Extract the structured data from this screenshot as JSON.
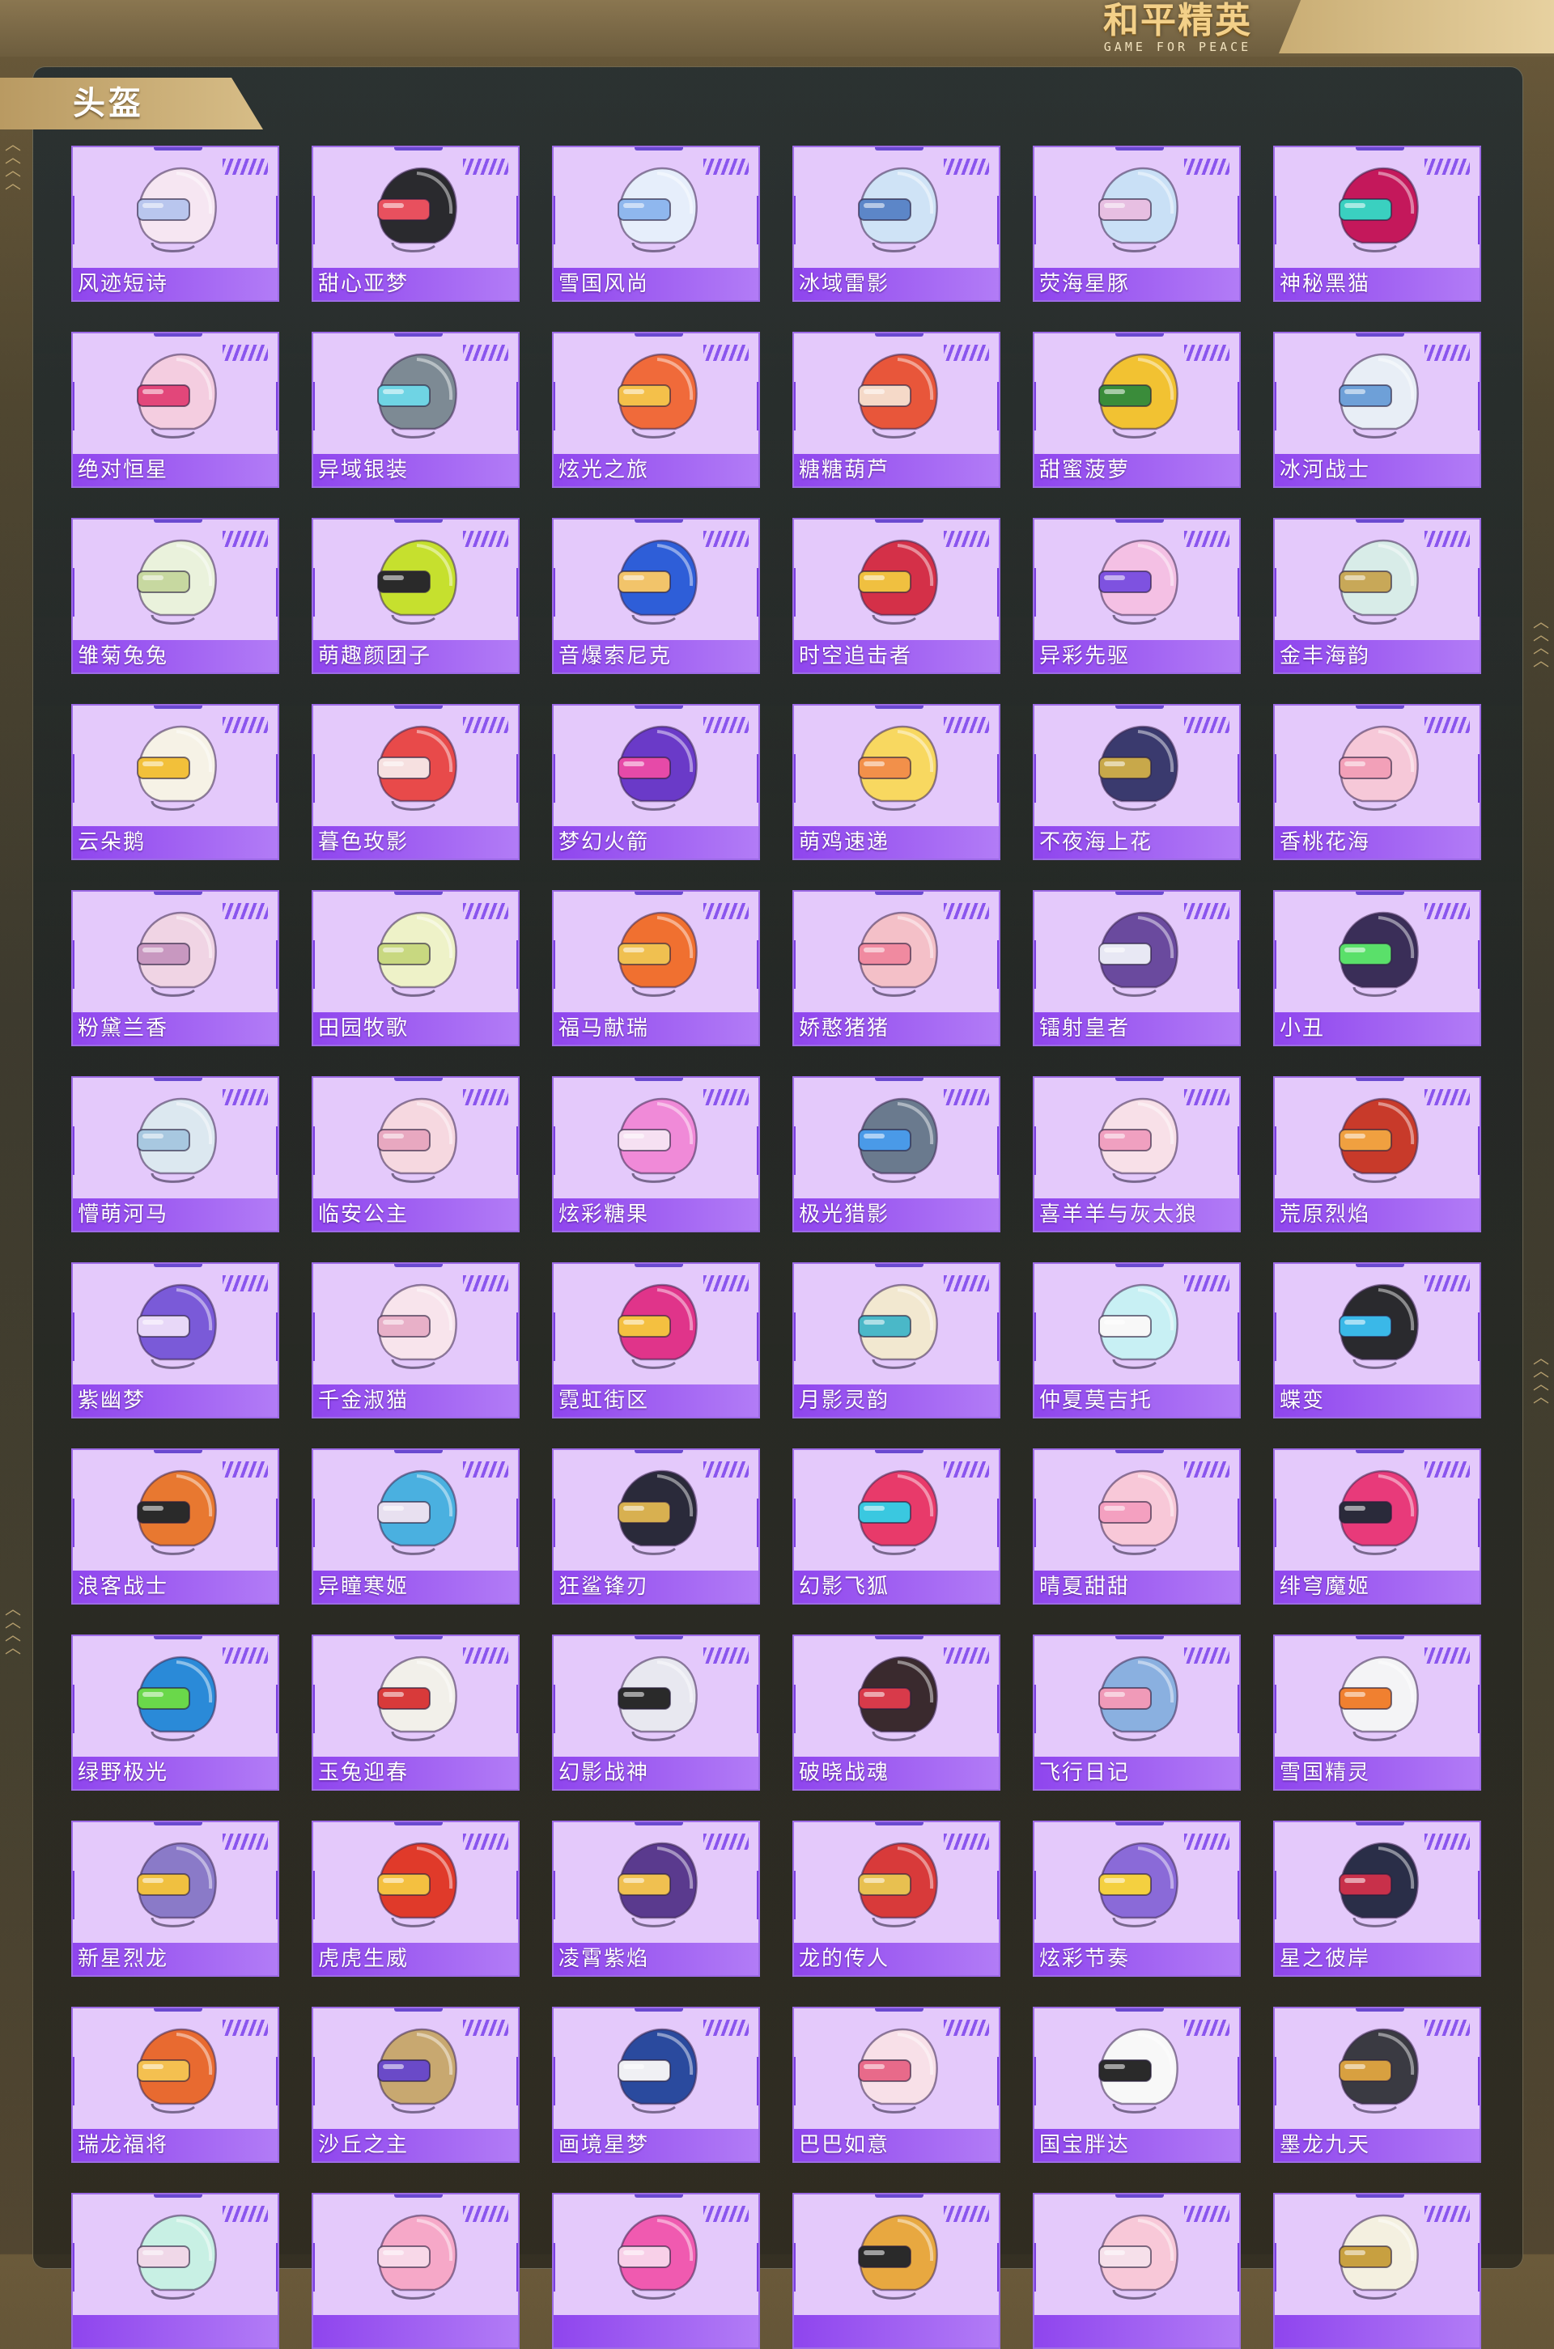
{
  "brand": {
    "name_cn": "和平精英",
    "name_en": "GAME FOR PEACE"
  },
  "section": {
    "title": "头盔"
  },
  "accent_colors": {
    "card_bg": "#e4c9fb",
    "label_bar": "#8f45ee",
    "header_gold": "#c9ad74"
  },
  "items": [
    {
      "label": "风迹短诗",
      "c1": "#f6e6f2",
      "c2": "#b9c6ee"
    },
    {
      "label": "甜心亚梦",
      "c1": "#2a2a2e",
      "c2": "#e8505e"
    },
    {
      "label": "雪国风尚",
      "c1": "#e6eefb",
      "c2": "#8fb7ee"
    },
    {
      "label": "冰域雷影",
      "c1": "#cfe3f6",
      "c2": "#5c86c8"
    },
    {
      "label": "荧海星豚",
      "c1": "#c9e0f6",
      "c2": "#e7bfe2"
    },
    {
      "label": "神秘黑猫",
      "c1": "#c4185b",
      "c2": "#3ad0c0"
    },
    {
      "label": "绝对恒星",
      "c1": "#f4cde0",
      "c2": "#e2477a"
    },
    {
      "label": "异域银装",
      "c1": "#7d8a94",
      "c2": "#6fd4e4"
    },
    {
      "label": "炫光之旅",
      "c1": "#f06a3a",
      "c2": "#f4c04a"
    },
    {
      "label": "糖糖葫芦",
      "c1": "#e8563a",
      "c2": "#f5d9c8"
    },
    {
      "label": "甜蜜菠萝",
      "c1": "#f2c232",
      "c2": "#3a8c3a"
    },
    {
      "label": "冰河战士",
      "c1": "#e8eef6",
      "c2": "#6ea0d8"
    },
    {
      "label": "雏菊兔兔",
      "c1": "#eaf2dc",
      "c2": "#c7d8a0"
    },
    {
      "label": "萌趣颜团子",
      "c1": "#c6e02e",
      "c2": "#2a2a2a"
    },
    {
      "label": "音爆索尼克",
      "c1": "#2e5ed8",
      "c2": "#f2c46a"
    },
    {
      "label": "时空追击者",
      "c1": "#d43048",
      "c2": "#f0c040"
    },
    {
      "label": "异彩先驱",
      "c1": "#f4c0e4",
      "c2": "#7e52e0"
    },
    {
      "label": "金丰海韵",
      "c1": "#d8ece8",
      "c2": "#c8a858"
    },
    {
      "label": "云朵鹅",
      "c1": "#f6f2e6",
      "c2": "#f2c03a"
    },
    {
      "label": "暮色玫影",
      "c1": "#e84a4a",
      "c2": "#f6e0e0"
    },
    {
      "label": "梦幻火箭",
      "c1": "#6a3ac8",
      "c2": "#e64aa8"
    },
    {
      "label": "萌鸡速递",
      "c1": "#f8d860",
      "c2": "#f2904a"
    },
    {
      "label": "不夜海上花",
      "c1": "#3a3a6e",
      "c2": "#c8a84a"
    },
    {
      "label": "香桃花海",
      "c1": "#f6c8d8",
      "c2": "#f2a0b8"
    },
    {
      "label": "粉黛兰香",
      "c1": "#f0d4e4",
      "c2": "#c898c0"
    },
    {
      "label": "田园牧歌",
      "c1": "#eef2c8",
      "c2": "#c8d880"
    },
    {
      "label": "福马献瑞",
      "c1": "#f07030",
      "c2": "#f0c050"
    },
    {
      "label": "娇憨猪猪",
      "c1": "#f4c0c8",
      "c2": "#f08aa0"
    },
    {
      "label": "镭射皇者",
      "c1": "#6a4a9e",
      "c2": "#e8e8f4"
    },
    {
      "label": "小丑",
      "c1": "#3a2e58",
      "c2": "#5ae06a"
    },
    {
      "label": "懵萌河马",
      "c1": "#dce8f0",
      "c2": "#a8c8e0"
    },
    {
      "label": "临安公主",
      "c1": "#f6d8e0",
      "c2": "#e8a8c0"
    },
    {
      "label": "炫彩糖果",
      "c1": "#f08ad8",
      "c2": "#f6e0f2"
    },
    {
      "label": "极光猎影",
      "c1": "#6a7a8e",
      "c2": "#4a9ae8"
    },
    {
      "label": "喜羊羊与灰太狼",
      "c1": "#f8e0e8",
      "c2": "#f0a0c0"
    },
    {
      "label": "荒原烈焰",
      "c1": "#c83a2a",
      "c2": "#f0a040"
    },
    {
      "label": "紫幽梦",
      "c1": "#7a5ad8",
      "c2": "#e8d8f8"
    },
    {
      "label": "千金淑猫",
      "c1": "#f8e4ec",
      "c2": "#e8b0c8"
    },
    {
      "label": "霓虹街区",
      "c1": "#e0348a",
      "c2": "#f4c040"
    },
    {
      "label": "月影灵韵",
      "c1": "#f2e8d0",
      "c2": "#4ab8c8"
    },
    {
      "label": "仲夏莫吉托",
      "c1": "#c8f0f4",
      "c2": "#f8f8f8"
    },
    {
      "label": "蝶变",
      "c1": "#2a2a2e",
      "c2": "#3ab8e8"
    },
    {
      "label": "浪客战士",
      "c1": "#e87830",
      "c2": "#2a2a2a"
    },
    {
      "label": "异瞳寒姬",
      "c1": "#4ab0e0",
      "c2": "#e8e0f0"
    },
    {
      "label": "狂鲨锋刃",
      "c1": "#2a2a3a",
      "c2": "#d8b050"
    },
    {
      "label": "幻影飞狐",
      "c1": "#e83a6a",
      "c2": "#3ac8e0"
    },
    {
      "label": "晴夏甜甜",
      "c1": "#f8c8d8",
      "c2": "#f4a0c0"
    },
    {
      "label": "绯穹魔姬",
      "c1": "#e83a7a",
      "c2": "#2a2a3a"
    },
    {
      "label": "绿野极光",
      "c1": "#2a8ad8",
      "c2": "#6ad84a"
    },
    {
      "label": "玉兔迎春",
      "c1": "#f2f0ea",
      "c2": "#d83a3a"
    },
    {
      "label": "幻影战神",
      "c1": "#e8e8f0",
      "c2": "#2a2a2a"
    },
    {
      "label": "破晓战魂",
      "c1": "#3a2a2e",
      "c2": "#d83a4a"
    },
    {
      "label": "飞行日记",
      "c1": "#8ab0e0",
      "c2": "#f09ab8"
    },
    {
      "label": "雪国精灵",
      "c1": "#f4f4f6",
      "c2": "#f08030"
    },
    {
      "label": "新星烈龙",
      "c1": "#8a7ac8",
      "c2": "#f0c040"
    },
    {
      "label": "虎虎生威",
      "c1": "#e03a2a",
      "c2": "#f4c040"
    },
    {
      "label": "凌霄紫焰",
      "c1": "#5a3a8e",
      "c2": "#f0c050"
    },
    {
      "label": "龙的传人",
      "c1": "#d83a3a",
      "c2": "#e8c050"
    },
    {
      "label": "炫彩节奏",
      "c1": "#8a6ad8",
      "c2": "#f4d040"
    },
    {
      "label": "星之彼岸",
      "c1": "#2a2e48",
      "c2": "#c8304a"
    },
    {
      "label": "瑞龙福将",
      "c1": "#e86a30",
      "c2": "#f4c050"
    },
    {
      "label": "沙丘之主",
      "c1": "#c8a870",
      "c2": "#6a4ac8"
    },
    {
      "label": "画境星梦",
      "c1": "#2a4a9e",
      "c2": "#f0f0f4"
    },
    {
      "label": "巴巴如意",
      "c1": "#f8e0e8",
      "c2": "#e86a8a"
    },
    {
      "label": "国宝胖达",
      "c1": "#f8f8f8",
      "c2": "#2a2a2a"
    },
    {
      "label": "墨龙九天",
      "c1": "#3a3a42",
      "c2": "#d8a040"
    },
    {
      "label": "",
      "c1": "#c8f0e4",
      "c2": "#f0d8e8"
    },
    {
      "label": "",
      "c1": "#f6a8c8",
      "c2": "#f8d8e8"
    },
    {
      "label": "",
      "c1": "#f05ab0",
      "c2": "#f8d0e8"
    },
    {
      "label": "",
      "c1": "#e8a840",
      "c2": "#2a2a2a"
    },
    {
      "label": "",
      "c1": "#f8c8d8",
      "c2": "#f6e0ea"
    },
    {
      "label": "",
      "c1": "#f4f0e0",
      "c2": "#c8a040"
    }
  ]
}
